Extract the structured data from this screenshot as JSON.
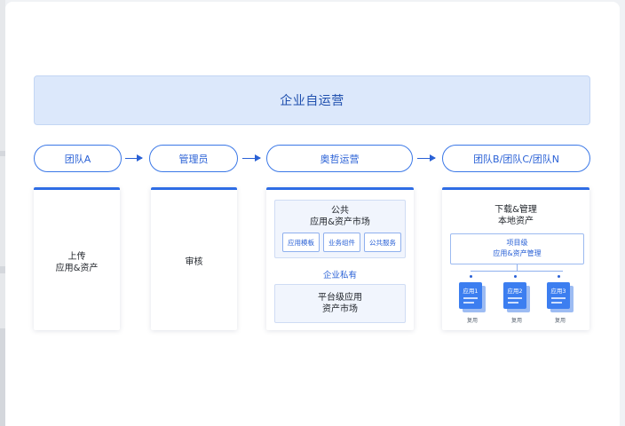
{
  "banner": {
    "text": "企业自运营"
  },
  "flow": [
    {
      "label": "团队A"
    },
    {
      "label": "管理员"
    },
    {
      "label": "奥哲运营"
    },
    {
      "label": "团队B/团队C/团队N"
    }
  ],
  "cards": {
    "upload": {
      "line1": "上传",
      "line2": "应用&资产"
    },
    "review": {
      "text": "审核"
    },
    "operations": {
      "public_box": {
        "line1": "公共",
        "line2": "应用&资产市场",
        "chips": [
          "应用模板",
          "业务组件",
          "公共服务"
        ]
      },
      "private_label": "企业私有",
      "platform_box": {
        "line1": "平台级应用",
        "line2": "资产市场"
      }
    },
    "download": {
      "line1": "下载&管理",
      "line2": "本地资产",
      "project_box": {
        "line1": "项目级",
        "line2": "应用&资产管理"
      },
      "apps": [
        {
          "name": "应用1",
          "caption": "复用"
        },
        {
          "name": "应用2",
          "caption": "复用"
        },
        {
          "name": "应用3",
          "caption": "复用"
        }
      ]
    }
  },
  "colors": {
    "accent": "#2a61d6",
    "banner_bg": "#dce8fb",
    "card_top": "#2f6de5"
  }
}
